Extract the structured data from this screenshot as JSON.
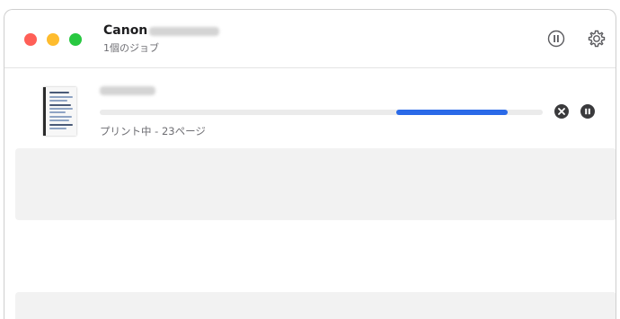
{
  "window": {
    "traffic_lights": {
      "close_color": "#ff5f57",
      "minimize_color": "#febc2e",
      "zoom_color": "#28c840"
    }
  },
  "header": {
    "printer_name": "Canon",
    "job_count": "1個のジョブ",
    "pause_icon": "pause-circle-icon",
    "settings_icon": "gear-icon"
  },
  "job": {
    "status": "プリント中 - 23ページ",
    "progress_start": 0.67,
    "progress_end": 0.92,
    "progress_color": "#2a6ae8",
    "cancel_icon": "cancel-circle-icon",
    "pause_icon": "pause-circle-icon"
  }
}
